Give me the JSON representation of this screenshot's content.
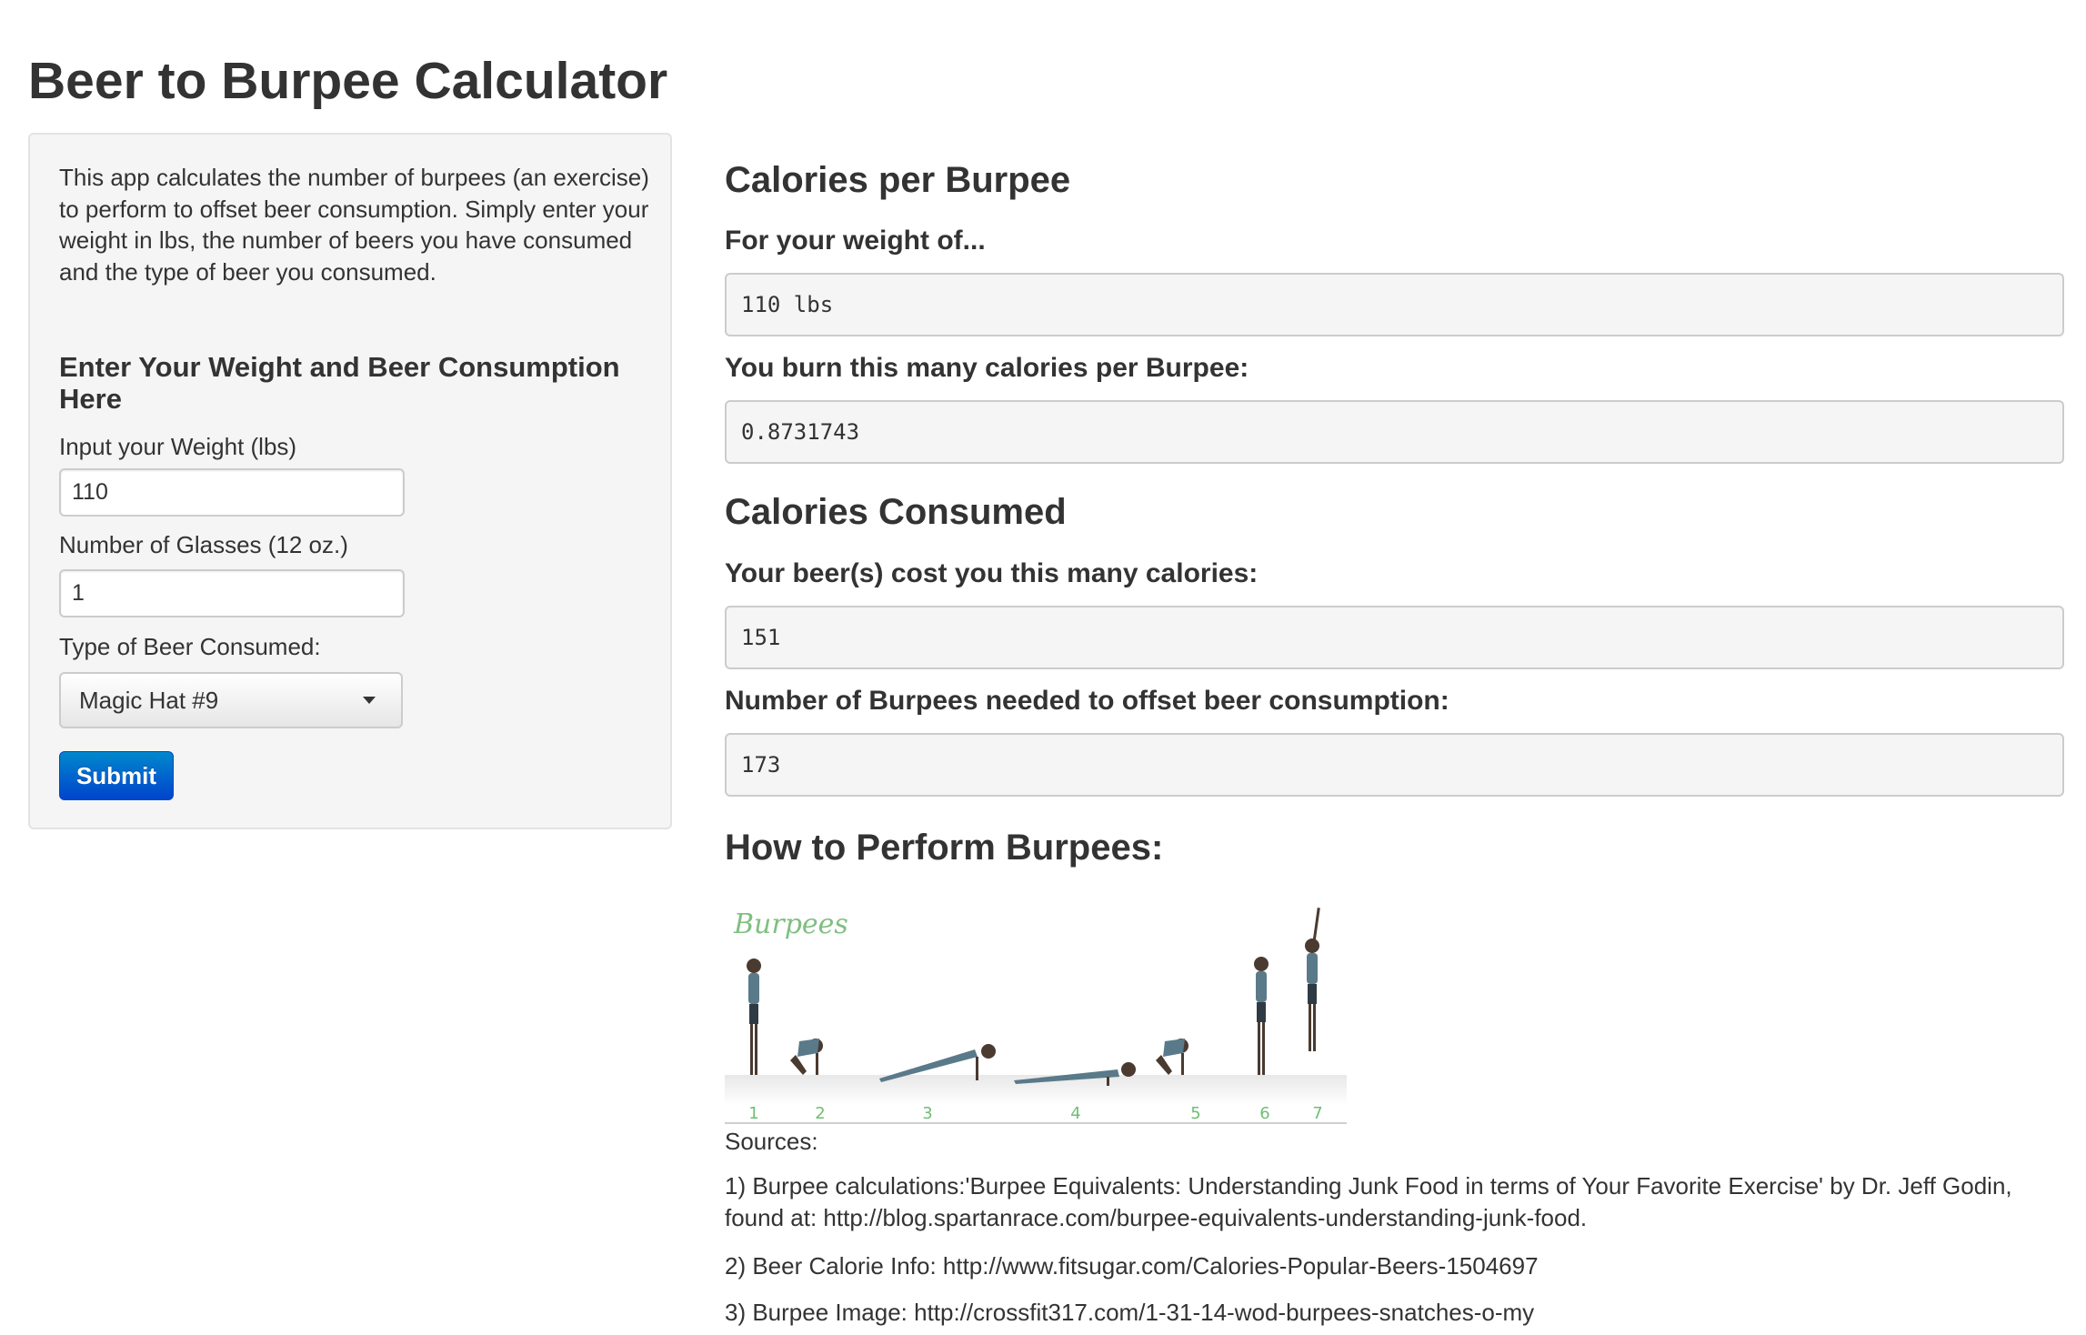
{
  "page": {
    "title": "Beer to Burpee Calculator"
  },
  "sidebar": {
    "description": "This app calculates the number of burpees (an exercise) to perform to offset beer consumption. Simply enter your weight in lbs, the number of beers you have consumed and the type of beer you consumed.",
    "heading": "Enter Your Weight and Beer Consumption Here",
    "weight_label": "Input your Weight (lbs)",
    "weight_value": "110",
    "glasses_label": "Number of Glasses (12 oz.)",
    "glasses_value": "1",
    "beer_type_label": "Type of Beer Consumed:",
    "beer_type_selected": "Magic Hat #9",
    "submit_label": "Submit"
  },
  "main": {
    "calories_per_burpee": {
      "heading": "Calories per Burpee",
      "weight_label": "For your weight of...",
      "weight_output": "110 lbs",
      "burn_label": "You burn this many calories per Burpee:",
      "burn_output": "0.8731743"
    },
    "calories_consumed": {
      "heading": "Calories Consumed",
      "cost_label": "Your beer(s) cost you this many calories:",
      "cost_output": "151",
      "burpees_label": "Number of Burpees needed to offset beer consumption:",
      "burpees_output": "173"
    },
    "how_to": {
      "heading": "How to Perform Burpees:",
      "image_caption": "Burpees",
      "steps": [
        "1",
        "2",
        "3",
        "4",
        "5",
        "6",
        "7"
      ]
    },
    "sources": {
      "heading": "Sources:",
      "items": [
        "1) Burpee calculations:'Burpee Equivalents: Understanding Junk Food in terms of Your Favorite Exercise' by Dr. Jeff Godin, found at: http://blog.spartanrace.com/burpee-equivalents-understanding-junk-food.",
        "2) Beer Calorie Info: http://www.fitsugar.com/Calories-Popular-Beers-1504697",
        "3) Burpee Image: http://crossfit317.com/1-31-14-wod-burpees-snatches-o-my"
      ]
    }
  },
  "colors": {
    "panel_bg": "#f5f5f5",
    "button_primary": "#0055cc",
    "step_number": "#6fbf73"
  },
  "icons": {
    "select_caret": "caret-down-icon"
  }
}
